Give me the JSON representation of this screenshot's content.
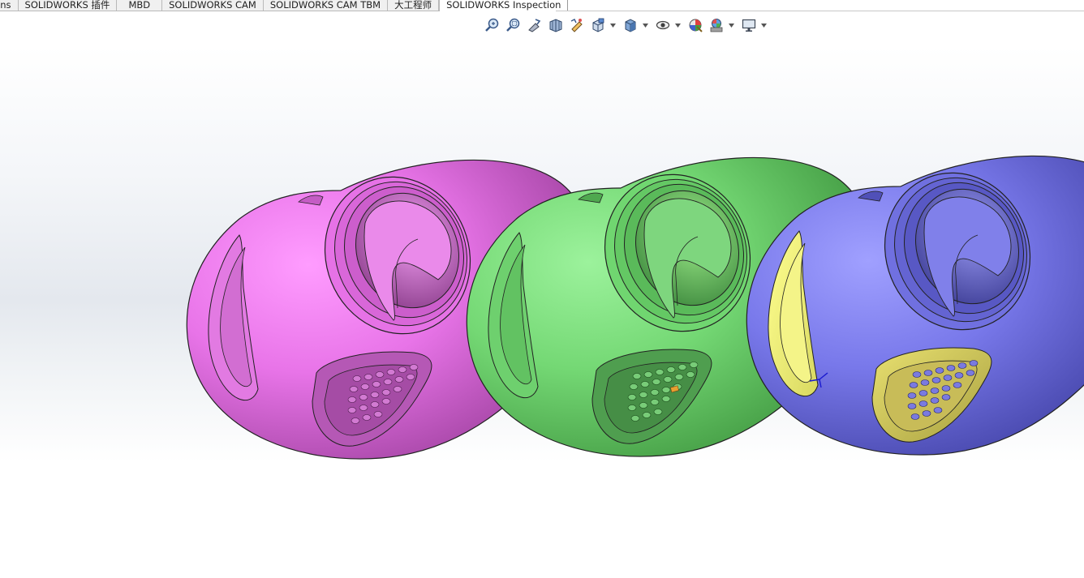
{
  "command_manager": {
    "tabs": [
      {
        "label": "ions"
      },
      {
        "label": "SOLIDWORKS 插件"
      },
      {
        "label": "MBD"
      },
      {
        "label": "SOLIDWORKS CAM"
      },
      {
        "label": "SOLIDWORKS CAM TBM"
      },
      {
        "label": "大工程师"
      },
      {
        "label": "SOLIDWORKS Inspection"
      }
    ],
    "active_tab": "SOLIDWORKS Inspection"
  },
  "heads_up_toolbar": {
    "buttons": [
      {
        "icon": "zoom-to-fit-icon"
      },
      {
        "icon": "zoom-to-area-icon"
      },
      {
        "icon": "previous-view-icon"
      },
      {
        "icon": "section-view-icon"
      },
      {
        "icon": "dynamic-annotation-views-icon"
      },
      {
        "icon": "view-orientation-icon",
        "dropdown": true
      },
      {
        "icon": "display-style-icon",
        "dropdown": true
      },
      {
        "icon": "hide-show-items-icon",
        "dropdown": true
      },
      {
        "icon": "edit-appearance-icon"
      },
      {
        "icon": "apply-scene-icon",
        "dropdown": true
      },
      {
        "icon": "view-settings-icon",
        "dropdown": true
      }
    ]
  },
  "graphics_area": {
    "background_top": "#ffffff",
    "background_mid": "#e4e8ee",
    "parts": [
      {
        "name": "magenta-body",
        "color": "#f07ef0",
        "shade": "#a94aa9"
      },
      {
        "name": "green-body",
        "color": "#7ee07e",
        "shade": "#3f9a3f"
      },
      {
        "name": "blue-body",
        "color": "#8383ef",
        "shade": "#4646a8",
        "highlight_color": "#ffff80"
      }
    ]
  }
}
